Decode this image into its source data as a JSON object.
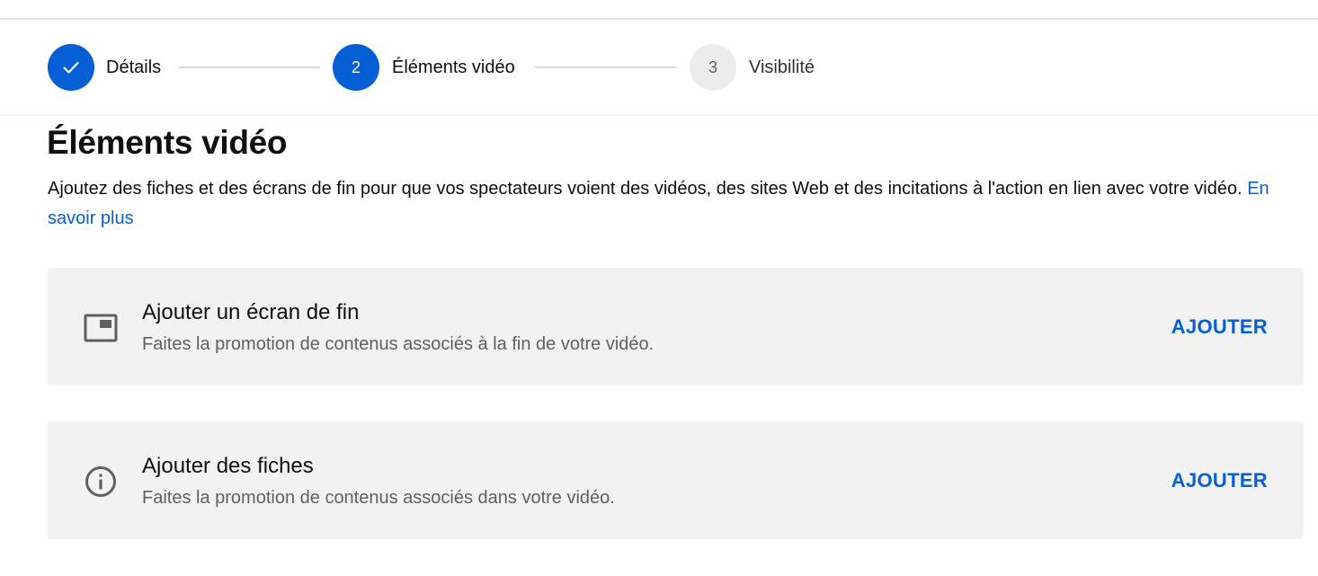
{
  "stepper": {
    "steps": [
      {
        "label": "Détails",
        "state": "done",
        "number": "1",
        "icon": "check-icon"
      },
      {
        "label": "Éléments vidéo",
        "state": "active",
        "number": "2"
      },
      {
        "label": "Visibilité",
        "state": "todo",
        "number": "3"
      }
    ]
  },
  "section": {
    "title": "Éléments vidéo",
    "description": "Ajoutez des fiches et des écrans de fin pour que vos spectateurs voient des vidéos, des sites Web et des incitations à l'action en lien avec votre vidéo.",
    "learn_more": "En savoir plus"
  },
  "cards": [
    {
      "icon": "end-screen-icon",
      "title": "Ajouter un écran de fin",
      "subtitle": "Faites la promotion de contenus associés à la fin de votre vidéo.",
      "action": "AJOUTER"
    },
    {
      "icon": "info-icon",
      "title": "Ajouter des fiches",
      "subtitle": "Faites la promotion de contenus associés dans votre vidéo.",
      "action": "AJOUTER"
    }
  ],
  "colors": {
    "accent": "#065fd4",
    "card_background": "#f2f2f2",
    "secondary_text": "#606060",
    "pending_step": "#ececec"
  }
}
